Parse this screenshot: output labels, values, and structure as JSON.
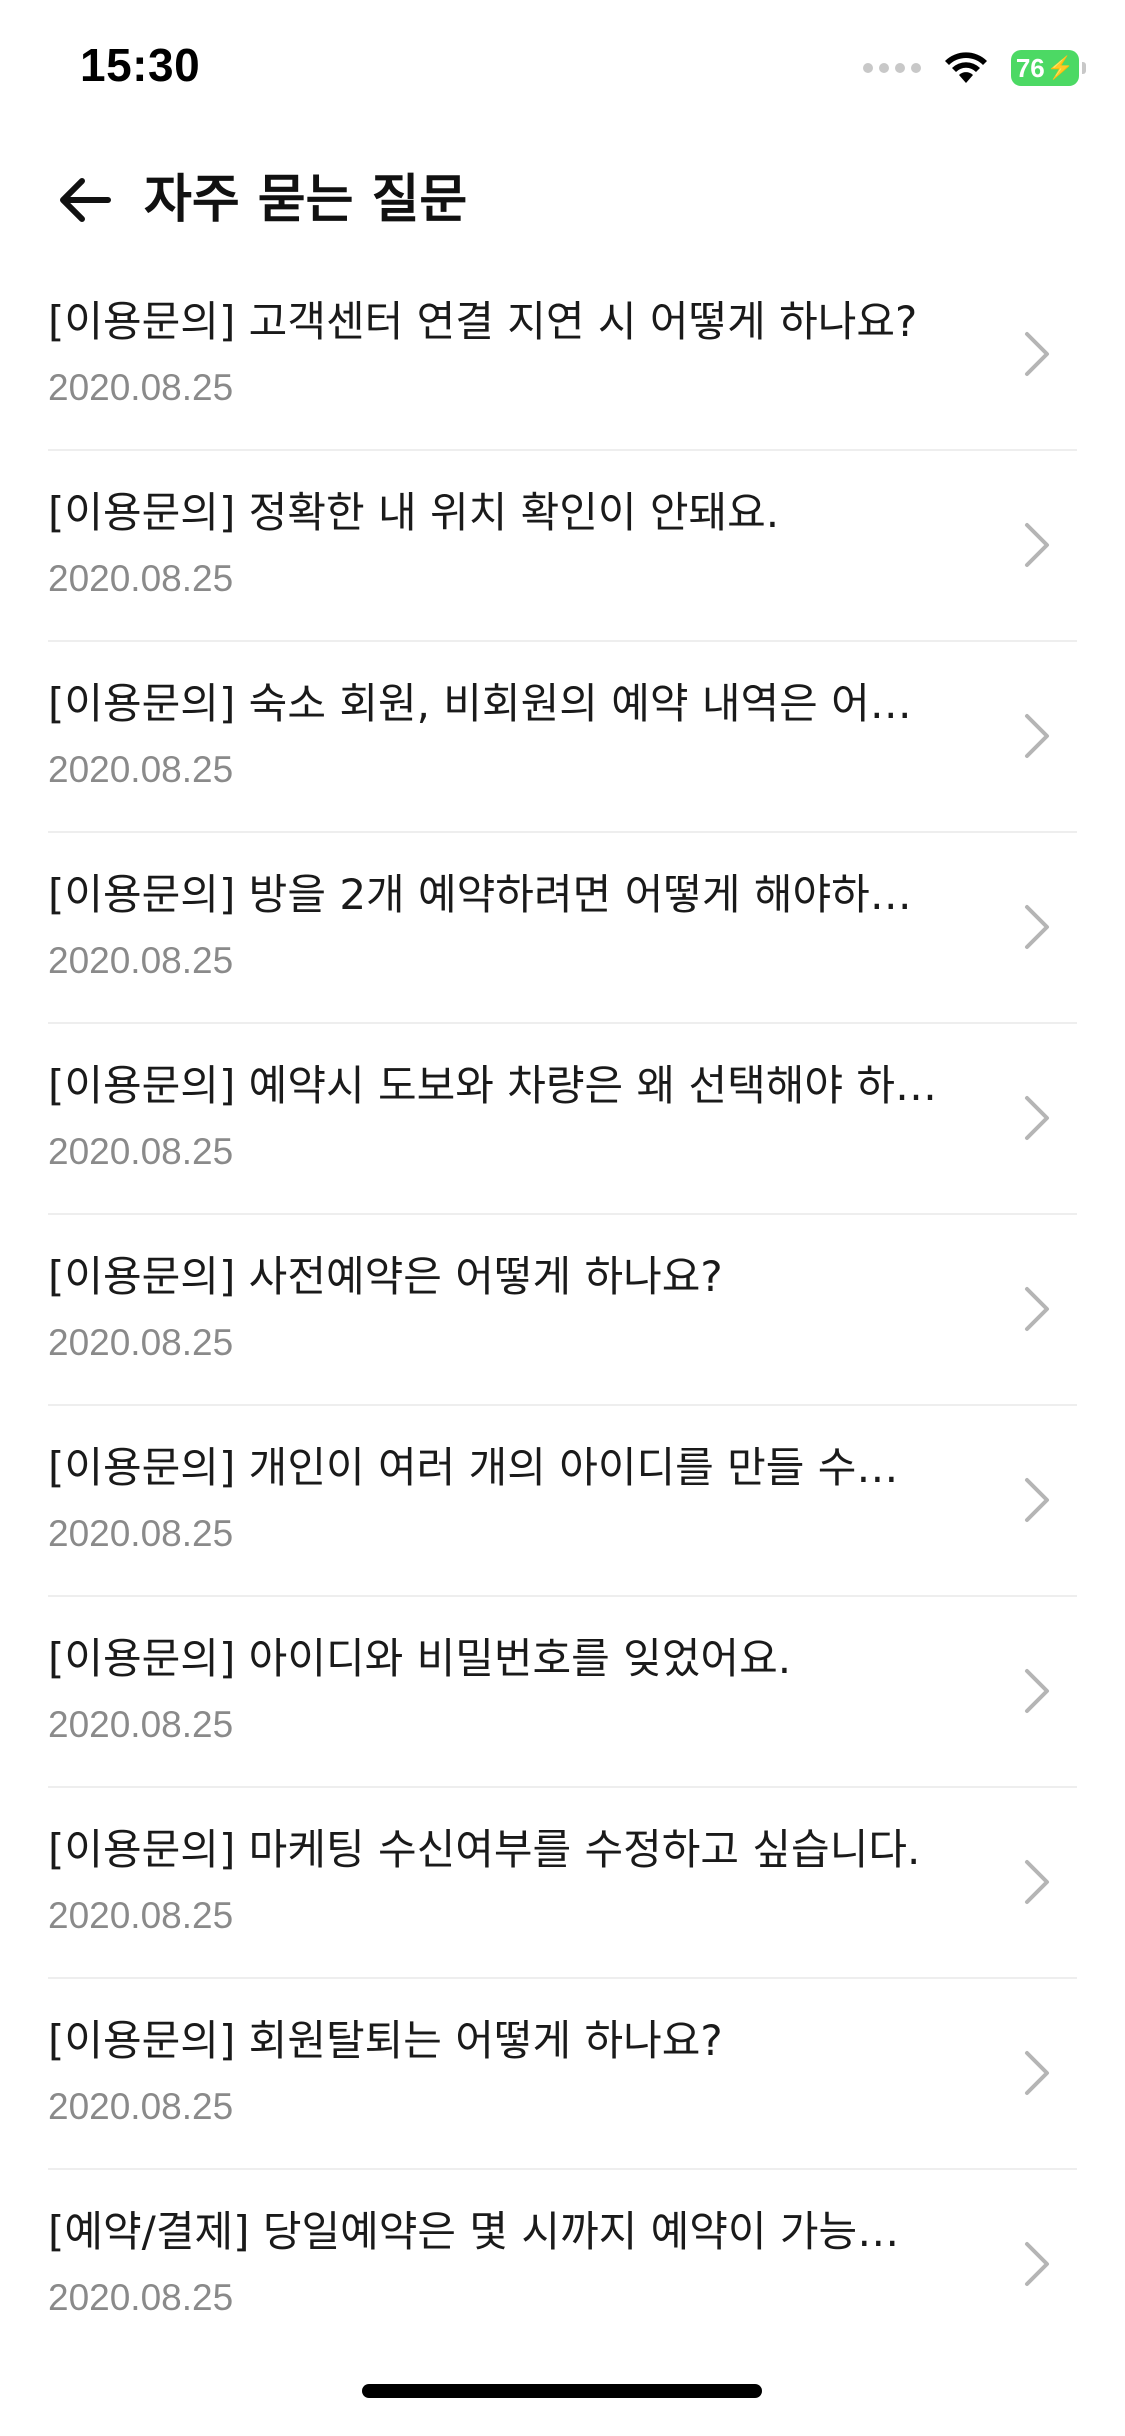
{
  "status_bar": {
    "time": "15:30",
    "battery": "76",
    "icons": [
      "signal-dots-icon",
      "wifi-icon",
      "battery-charging-icon"
    ]
  },
  "header": {
    "back_icon": "arrow-left-icon",
    "title": "자주 묻는 질문"
  },
  "faq": {
    "items": [
      {
        "title": "[이용문의] 고객센터 연결 지연 시 어떻게 하나요?",
        "date": "2020.08.25"
      },
      {
        "title": "[이용문의] 정확한 내 위치 확인이 안돼요.",
        "date": "2020.08.25"
      },
      {
        "title": "[이용문의] 숙소 회원, 비회원의 예약 내역은 어…",
        "date": "2020.08.25"
      },
      {
        "title": "[이용문의] 방을 2개 예약하려면 어떻게 해야하…",
        "date": "2020.08.25"
      },
      {
        "title": "[이용문의] 예약시 도보와 차량은 왜 선택해야 하…",
        "date": "2020.08.25"
      },
      {
        "title": "[이용문의] 사전예약은 어떻게 하나요?",
        "date": "2020.08.25"
      },
      {
        "title": "[이용문의] 개인이 여러 개의 아이디를 만들 수…",
        "date": "2020.08.25"
      },
      {
        "title": "[이용문의] 아이디와 비밀번호를 잊었어요.",
        "date": "2020.08.25"
      },
      {
        "title": "[이용문의] 마케팅 수신여부를 수정하고 싶습니다.",
        "date": "2020.08.25"
      },
      {
        "title": "[이용문의] 회원탈퇴는 어떻게 하나요?",
        "date": "2020.08.25"
      },
      {
        "title": "[예약/결제] 당일예약은 몇 시까지 예약이 가능…",
        "date": "2020.08.25"
      }
    ]
  },
  "colors": {
    "battery": "#4cd964",
    "date_text": "#8a8a8a",
    "divider": "#eeeeee",
    "chevron": "#b5b5b5"
  }
}
